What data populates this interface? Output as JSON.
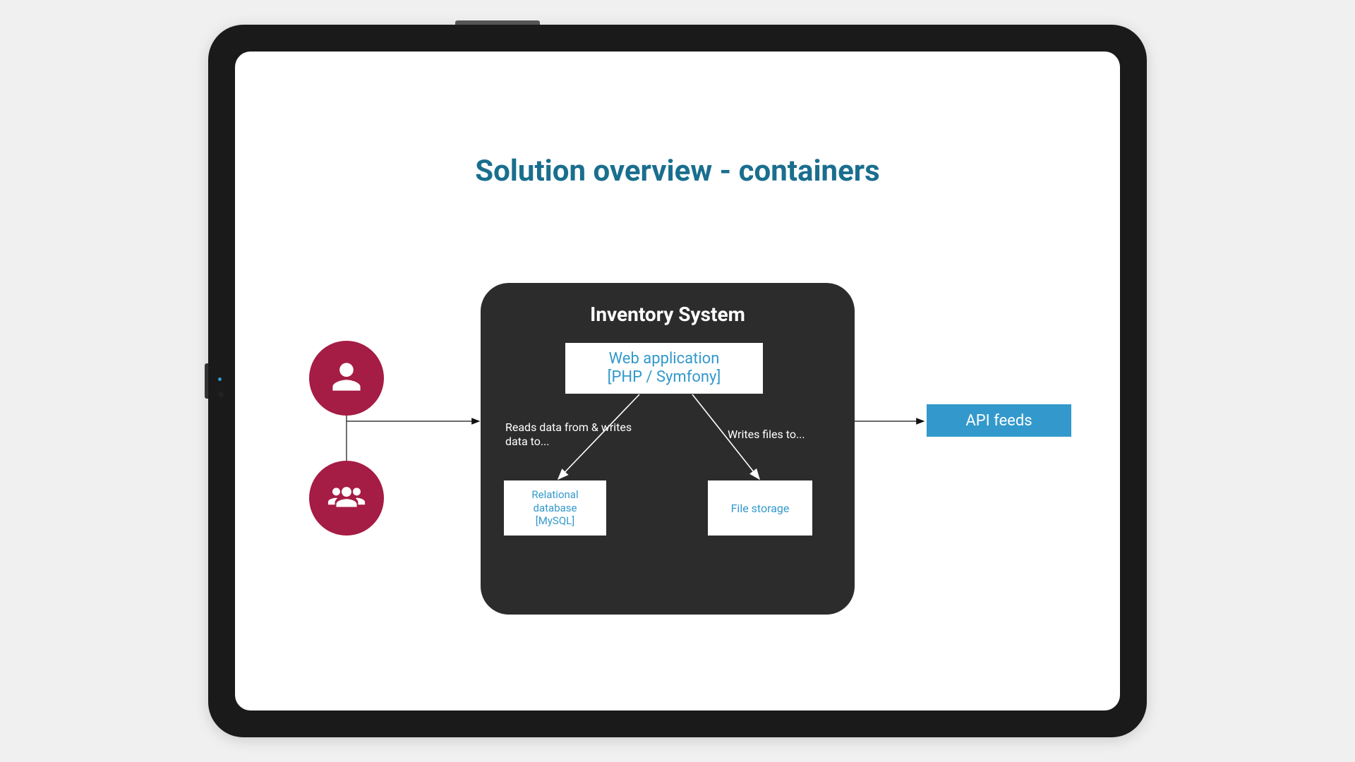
{
  "title": "Solution overview - containers",
  "system": {
    "name": "Inventory System",
    "webapp": {
      "line1": "Web application",
      "line2": "[PHP / Symfony]"
    },
    "database": {
      "line1": "Relational",
      "line2": "database",
      "line3": "[MySQL]"
    },
    "filestore": "File storage",
    "edge_db": "Reads data from & writes data to...",
    "edge_fs": "Writes files to..."
  },
  "external": {
    "api": "API feeds"
  },
  "actors": {
    "single": "user-icon",
    "group": "users-icon"
  },
  "colors": {
    "accent_teal": "#1a6e8e",
    "link_blue": "#3399cc",
    "actor_red": "#a51c44",
    "box_dark": "#2c2c2c"
  }
}
